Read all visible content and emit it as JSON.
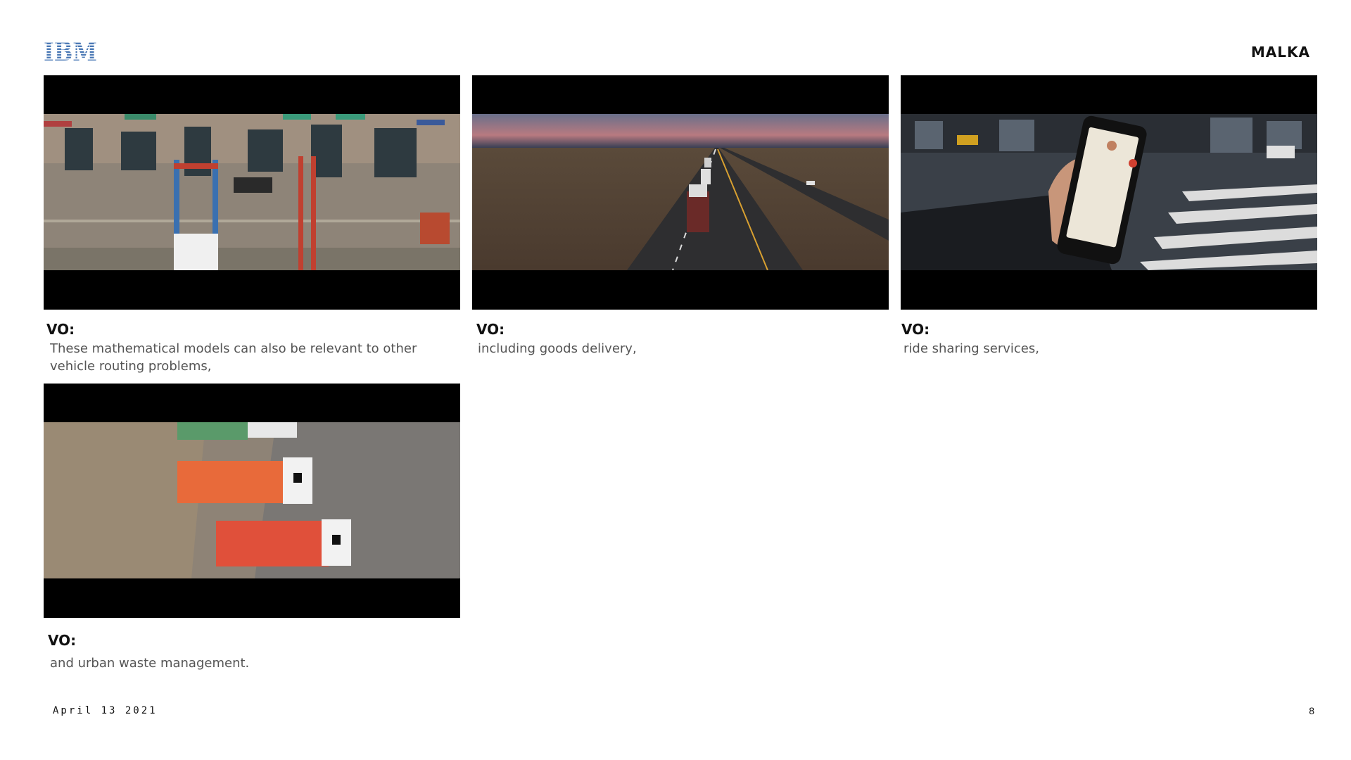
{
  "header": {
    "logo_text": "IBM",
    "client": "MALKA"
  },
  "panels": [
    {
      "vo_label": "VO:",
      "text": "These mathematical models can also be relevant to other vehicle routing problems,",
      "scene": "aerial port with shipping containers and cranes"
    },
    {
      "vo_label": "VO:",
      "text": "including goods delivery,",
      "scene": "trucks on a desert highway at dusk"
    },
    {
      "vo_label": "VO:",
      "text": "ride sharing services,",
      "scene": "hand holding phone with map app on city street"
    },
    {
      "vo_label": "VO:",
      "text": "and urban waste management.",
      "scene": "aerial view of orange garbage trucks"
    }
  ],
  "footer": {
    "date": "April 13 2021",
    "page": "8"
  },
  "colors": {
    "ibm_blue": "#4a78b5",
    "frame_black": "#000000",
    "text_gray": "#555555"
  }
}
